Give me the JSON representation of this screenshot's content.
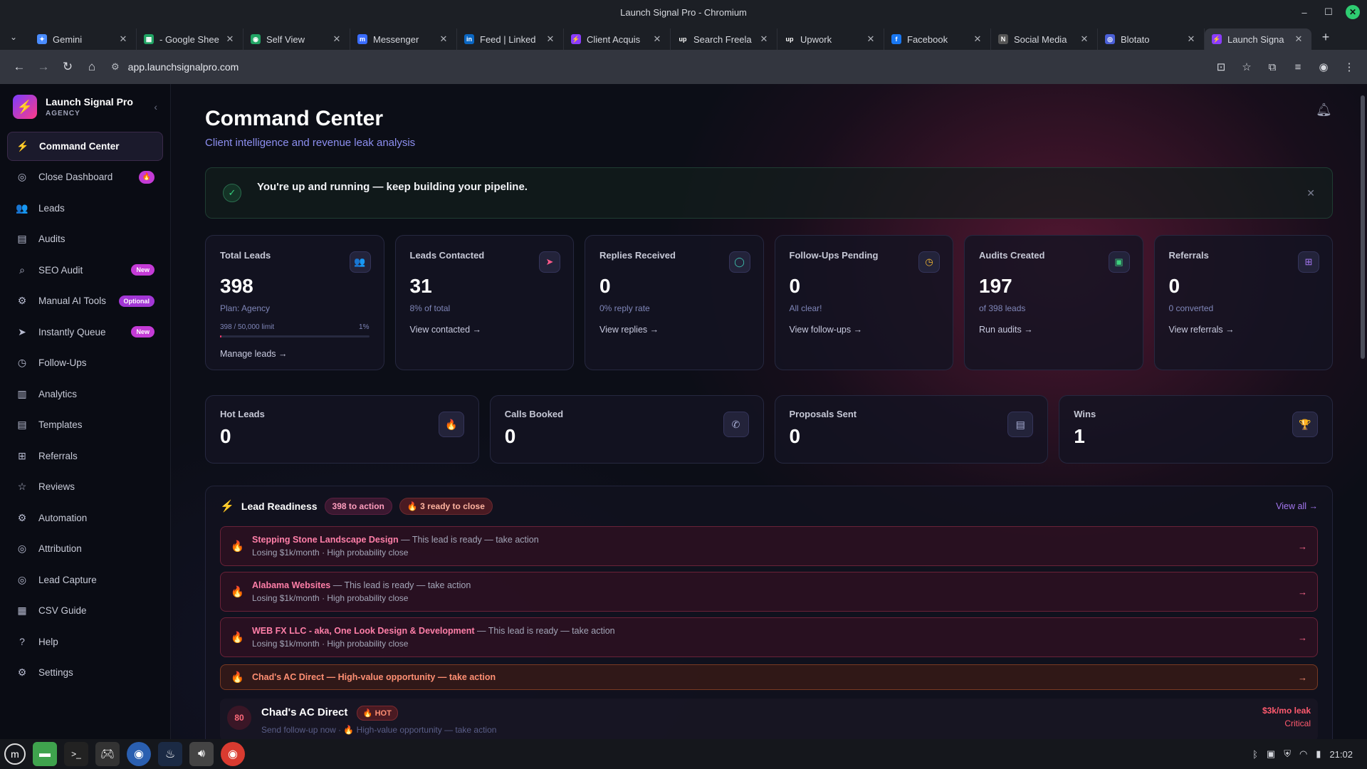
{
  "window": {
    "title": "Launch Signal Pro - Chromium"
  },
  "tabs": [
    {
      "title": "Gemini",
      "color": "#4a8cff",
      "glyph": "✦"
    },
    {
      "title": "- Google Shee",
      "color": "#21a464",
      "glyph": "▦"
    },
    {
      "title": "Self View",
      "color": "#21a464",
      "glyph": "◉"
    },
    {
      "title": "Messenger",
      "color": "#3a6dff",
      "glyph": "m"
    },
    {
      "title": "Feed | Linked",
      "color": "#0a66c2",
      "glyph": "in"
    },
    {
      "title": "Client Acquis",
      "color": "#8b3cff",
      "glyph": "⚡"
    },
    {
      "title": "Search Freela",
      "color": "#1c1f25",
      "glyph": "up"
    },
    {
      "title": "Upwork",
      "color": "#1c1f25",
      "glyph": "up"
    },
    {
      "title": "Facebook",
      "color": "#1877f2",
      "glyph": "f"
    },
    {
      "title": "Social Media",
      "color": "#555",
      "glyph": "N"
    },
    {
      "title": "Blotato",
      "color": "#4a5fd6",
      "glyph": "◎"
    },
    {
      "title": "Launch Signa",
      "color": "#8b3cff",
      "glyph": "⚡",
      "active": true
    }
  ],
  "address": {
    "url": "app.launchsignalpro.com"
  },
  "sidebar": {
    "brand": {
      "name": "Launch Signal Pro",
      "sub": "AGENCY"
    },
    "items": [
      {
        "label": "Command Center",
        "icon": "⚡"
      },
      {
        "label": "Close Dashboard",
        "icon": "◎",
        "badge": "🔥"
      },
      {
        "label": "Leads",
        "icon": "👥"
      },
      {
        "label": "Audits",
        "icon": "▤"
      },
      {
        "label": "SEO Audit",
        "icon": "⌕",
        "badge": "New"
      },
      {
        "label": "Manual AI Tools",
        "icon": "⚙",
        "badge": "Optional"
      },
      {
        "label": "Instantly Queue",
        "icon": "➤",
        "badge": "New"
      },
      {
        "label": "Follow-Ups",
        "icon": "◷"
      },
      {
        "label": "Analytics",
        "icon": "▥"
      },
      {
        "label": "Templates",
        "icon": "▤"
      },
      {
        "label": "Referrals",
        "icon": "⊞"
      },
      {
        "label": "Reviews",
        "icon": "☆"
      },
      {
        "label": "Automation",
        "icon": "⚙"
      },
      {
        "label": "Attribution",
        "icon": "◎"
      },
      {
        "label": "Lead Capture",
        "icon": "◎"
      },
      {
        "label": "CSV Guide",
        "icon": "▦"
      },
      {
        "label": "Help",
        "icon": "?"
      },
      {
        "label": "Settings",
        "icon": "⚙"
      }
    ]
  },
  "header": {
    "title": "Command Center",
    "subtitle": "Client intelligence and revenue leak analysis"
  },
  "banner": {
    "message": "You're up and running — keep building your pipeline."
  },
  "stats": [
    {
      "label": "Total Leads",
      "value": "398",
      "sub": "Plan: Agency",
      "limit": "398 / 50,000 limit",
      "pct": "1%",
      "progress": 0.01,
      "link": "Manage leads →",
      "icon": "👥",
      "color": "#8d8ff0"
    },
    {
      "label": "Leads Contacted",
      "value": "31",
      "sub": "8% of total",
      "link": "View contacted →",
      "icon": "➤",
      "color": "#ff5a8a"
    },
    {
      "label": "Replies Received",
      "value": "0",
      "sub": "0% reply rate",
      "link": "View replies →",
      "icon": "◯",
      "color": "#3ec6b0"
    },
    {
      "label": "Follow-Ups Pending",
      "value": "0",
      "sub": "All clear!",
      "link": "View follow-ups →",
      "icon": "◷",
      "color": "#f5b830"
    },
    {
      "label": "Audits Created",
      "value": "197",
      "sub": "of 398 leads",
      "link": "Run audits →",
      "icon": "▣",
      "color": "#3ed07e"
    },
    {
      "label": "Referrals",
      "value": "0",
      "sub": "0 converted",
      "link": "View referrals →",
      "icon": "⊞",
      "color": "#a477f0"
    }
  ],
  "stats2": [
    {
      "label": "Hot Leads",
      "value": "0",
      "icon": "🔥"
    },
    {
      "label": "Calls Booked",
      "value": "0",
      "icon": "✆"
    },
    {
      "label": "Proposals Sent",
      "value": "0",
      "icon": "▤"
    },
    {
      "label": "Wins",
      "value": "1",
      "icon": "🏆"
    }
  ],
  "readiness": {
    "title": "Lead Readiness",
    "pill_action": "398 to action",
    "pill_close": "🔥 3 ready to close",
    "view_all": "View all →",
    "rows": [
      {
        "name": "Stepping Stone Landscape Design",
        "action": " — This lead is ready — take action",
        "detail": "Losing $1k/month · High probability close"
      },
      {
        "name": "Alabama Websites",
        "action": " — This lead is ready — take action",
        "detail": "Losing $1k/month · High probability close"
      },
      {
        "name": "WEB FX LLC - aka, One Look Design & Development",
        "action": " — This lead is ready — take action",
        "detail": "Losing $1k/month · High probability close"
      }
    ],
    "opportunity": "Chad's AC Direct — High-value opportunity — take action",
    "hot_lead": {
      "score": "80",
      "name": "Chad's AC Direct",
      "badge": "🔥 HOT",
      "sub": "Send follow-up now · 🔥 High-value opportunity — take action",
      "leak": "$3k/mo leak",
      "severity": "Critical"
    }
  },
  "taskbar": {
    "time": "21:02"
  }
}
